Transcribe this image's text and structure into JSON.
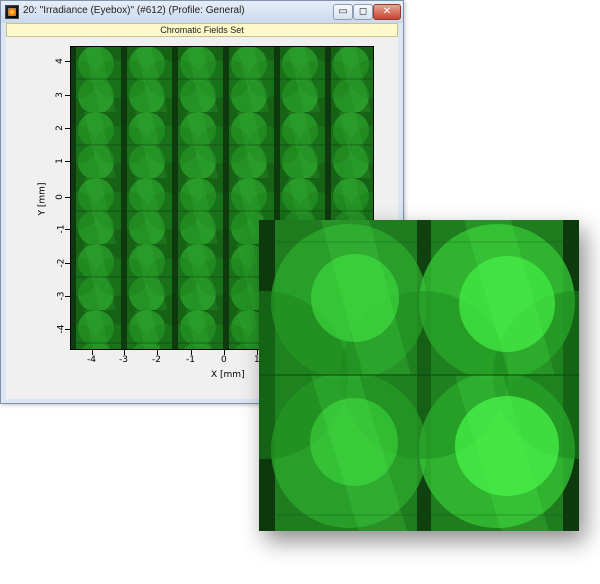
{
  "window": {
    "title": "20: \"Irradiance (Eyebox)\" (#612) (Profile: General)",
    "buttons": {
      "minimize": "▭",
      "maximize": "◻",
      "close": "✕"
    }
  },
  "caption": "Chromatic Fields Set",
  "plot": {
    "x_axis_label": "X [mm]",
    "y_axis_label": "Y [mm]",
    "x_ticks": [
      "-4",
      "-3",
      "-2",
      "-1",
      "0",
      "1"
    ],
    "y_ticks": [
      "4",
      "3",
      "2",
      "1",
      "0",
      "-1",
      "-2",
      "-3",
      "-4"
    ]
  },
  "colors": {
    "field_dark": "#0e3d0e",
    "field_mid": "#1f8a1f",
    "field_bright": "#33e333"
  }
}
